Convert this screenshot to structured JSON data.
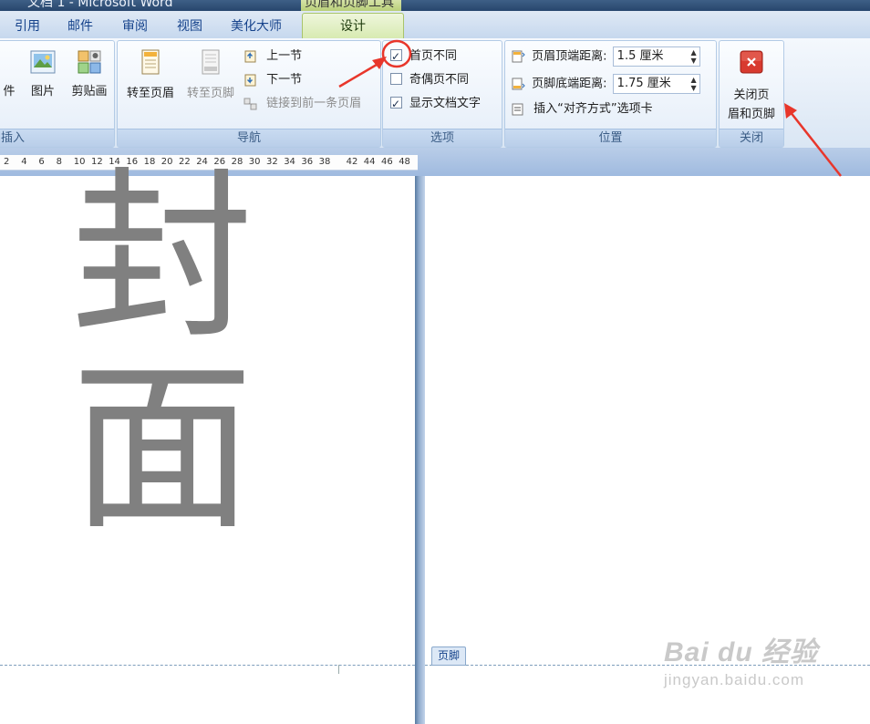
{
  "window": {
    "title": "文档 1 - Microsoft Word",
    "context_title": "页眉和页脚工具"
  },
  "tabs": [
    {
      "label": "引用"
    },
    {
      "label": "邮件"
    },
    {
      "label": "审阅"
    },
    {
      "label": "视图"
    },
    {
      "label": "美化大师"
    },
    {
      "label": "设计",
      "active": true
    }
  ],
  "groups": {
    "insert": {
      "label": "插入",
      "buttons": [
        {
          "label": "件",
          "icon": "document-parts-icon"
        },
        {
          "label": "图片",
          "icon": "picture-icon"
        },
        {
          "label": "剪贴画",
          "icon": "clipart-icon"
        }
      ]
    },
    "nav": {
      "label": "导航",
      "big": [
        {
          "label": "转至页眉",
          "icon": "goto-header-icon",
          "enabled": true
        },
        {
          "label": "转至页脚",
          "icon": "goto-footer-icon",
          "enabled": false
        }
      ],
      "small": [
        {
          "label": "上一节",
          "icon": "previous-section-icon",
          "enabled": true
        },
        {
          "label": "下一节",
          "icon": "next-section-icon",
          "enabled": true
        },
        {
          "label": "链接到前一条页眉",
          "icon": "link-previous-icon",
          "enabled": false
        }
      ]
    },
    "options": {
      "label": "选项",
      "items": [
        {
          "label": "首页不同",
          "checked": true
        },
        {
          "label": "奇偶页不同",
          "checked": false
        },
        {
          "label": "显示文档文字",
          "checked": true
        }
      ]
    },
    "position": {
      "label": "位置",
      "header_label": "页眉顶端距离:",
      "header_value": "1.5 厘米",
      "footer_label": "页脚底端距离:",
      "footer_value": "1.75 厘米",
      "insert_tab_label": "插入“对齐方式”选项卡"
    },
    "close": {
      "label": "关闭",
      "button_line1": "关闭页",
      "button_line2": "眉和页脚"
    }
  },
  "ruler": {
    "ticks": [
      "2",
      "4",
      "6",
      "8",
      "10",
      "12",
      "14",
      "16",
      "18",
      "20",
      "22",
      "24",
      "26",
      "28",
      "30",
      "32",
      "34",
      "36",
      "38",
      "42",
      "44",
      "46",
      "48"
    ]
  },
  "document": {
    "cover_char_1": "封",
    "cover_char_2": "面",
    "footer_tag": "页脚"
  },
  "watermark": {
    "main": "Bai du 经验",
    "sub": "jingyan.baidu.com"
  },
  "colors": {
    "accent": "#15428b",
    "active_tab": "#d7eab0",
    "annotation": "#e8362b",
    "cover_text": "#808080"
  }
}
